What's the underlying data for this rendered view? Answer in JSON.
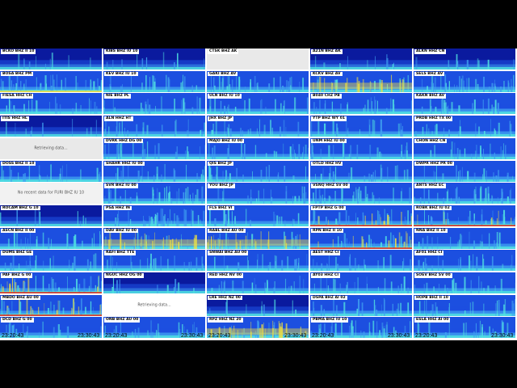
{
  "columns": [
    [
      {
        "label": "BCKO BHZ II 10",
        "state": "spec",
        "style": "dark"
      },
      {
        "label": "BOSA BHZ PM",
        "state": "spec",
        "style": "banded"
      },
      {
        "label": "FIESA HHZ CH",
        "state": "spec",
        "style": "medium"
      },
      {
        "label": "ITIS HHZ HL",
        "state": "spec",
        "style": "dark"
      },
      {
        "label": "",
        "state": "retrieving",
        "message": "Retrieving data..."
      },
      {
        "label": "DOSS BHZ II 10",
        "state": "spec",
        "style": "medium"
      },
      {
        "label": "",
        "state": "nodata",
        "message": "No recent data for FURI BHZ IU 10"
      },
      {
        "label": "ROCAM BHZ G 10",
        "state": "spec",
        "style": "dark"
      },
      {
        "label": "ASCN BHZ II 00",
        "state": "spec",
        "style": "medium"
      },
      {
        "label": "DUMS BHZ GE",
        "state": "spec",
        "style": "medium"
      },
      {
        "label": "PAF BHZ G 00",
        "state": "spec",
        "style": "noisy"
      },
      {
        "label": "MBDO BHZ AU 00",
        "state": "spec",
        "style": "noisy"
      },
      {
        "label": "DCD BHZ G 00",
        "state": "spec",
        "style": "medium"
      }
    ],
    [
      {
        "label": "KIBS BHZ IU 10",
        "state": "spec",
        "style": "dark"
      },
      {
        "label": "KEV BHZ IU 10",
        "state": "spec",
        "style": "medium"
      },
      {
        "label": "NIE BHZ PL",
        "state": "spec",
        "style": "medium"
      },
      {
        "label": "ALN HHZ HT",
        "state": "spec",
        "style": "medium"
      },
      {
        "label": "DVRK HHZ DG 00",
        "state": "spec",
        "style": "medium"
      },
      {
        "label": "SHAHR HHZ IU 00",
        "state": "spec",
        "style": "medium"
      },
      {
        "label": "SVR BHZ IU 00",
        "state": "spec",
        "style": "bright"
      },
      {
        "label": "PSA HHZ IN",
        "state": "spec",
        "style": "bright"
      },
      {
        "label": "DAV BHZ IU 00",
        "state": "spec",
        "style": "yellow"
      },
      {
        "label": "RAFI BHZ TTE",
        "state": "spec",
        "style": "medium"
      },
      {
        "label": "NGUC HHZ OG 00",
        "state": "spec",
        "style": "dark"
      },
      {
        "label": "",
        "state": "white",
        "message": "Retrieving data..."
      },
      {
        "label": "ONB BHZ AU 00",
        "state": "spec",
        "style": "medium"
      }
    ],
    [
      {
        "label": "CTSK BHZ AK",
        "state": "retrieving",
        "message": ""
      },
      {
        "label": "GAKI BHZ AV",
        "state": "spec",
        "style": "bright"
      },
      {
        "label": "ULN BHZ IU 10",
        "state": "spec",
        "style": "medium"
      },
      {
        "label": "JHX BHZ JP",
        "state": "spec",
        "style": "medium"
      },
      {
        "label": "MAJO BHZ IU 00",
        "state": "spec",
        "style": "medium"
      },
      {
        "label": "QIS BHZ JP",
        "state": "spec",
        "style": "medium"
      },
      {
        "label": "YOU BHZ JP",
        "state": "spec",
        "style": "medium"
      },
      {
        "label": "FLS BHZ VI",
        "state": "spec",
        "style": "medium"
      },
      {
        "label": "RABL BHZ AU 00",
        "state": "spec",
        "style": "yellow"
      },
      {
        "label": "SNWAI BHZ AU 00",
        "state": "spec",
        "style": "medium"
      },
      {
        "label": "RED HHZ NV 00",
        "state": "spec",
        "style": "medium"
      },
      {
        "label": "LRE HHZ NZ 00",
        "state": "spec",
        "style": "dark"
      },
      {
        "label": "RPZ HHZ NZ 20",
        "state": "spec",
        "style": "yellow"
      }
    ],
    [
      {
        "label": "A21N BHZ AK",
        "state": "spec",
        "style": "dark"
      },
      {
        "label": "KCKV BHZ AV",
        "state": "spec",
        "style": "yellow"
      },
      {
        "label": "B040 CHZ PB",
        "state": "spec",
        "style": "medium"
      },
      {
        "label": "YTP BHZ WY 01",
        "state": "spec",
        "style": "medium"
      },
      {
        "label": "UNM HHZ IU 00",
        "state": "spec",
        "style": "medium"
      },
      {
        "label": "OTLD HHZ HV",
        "state": "spec",
        "style": "medium"
      },
      {
        "label": "VSNQ HHZ SV 00",
        "state": "spec",
        "style": "bright"
      },
      {
        "label": "FPTP BHZ G 00",
        "state": "spec",
        "style": "noisy"
      },
      {
        "label": "RPN BHZ II 10",
        "state": "spec",
        "style": "noisy"
      },
      {
        "label": "AEST HHZ CI",
        "state": "spec",
        "style": "medium"
      },
      {
        "label": "AY03 HHZ CI",
        "state": "spec",
        "style": "medium"
      },
      {
        "label": "DSPA BHZ AI 02",
        "state": "spec",
        "style": "medium"
      },
      {
        "label": "PBMA BHZ IU 10",
        "state": "spec",
        "style": "bright"
      }
    ],
    [
      {
        "label": "ALKN HHZ CN",
        "state": "spec",
        "style": "dark"
      },
      {
        "label": "SELS BHZ AV",
        "state": "spec",
        "style": "bright"
      },
      {
        "label": "KAKN BHZ AV",
        "state": "spec",
        "style": "medium"
      },
      {
        "label": "PRDB HHZ TX 00",
        "state": "spec",
        "style": "medium"
      },
      {
        "label": "CHON HHZ CN",
        "state": "spec",
        "style": "medium"
      },
      {
        "label": "DWPR HHZ PR 00",
        "state": "spec",
        "style": "medium"
      },
      {
        "label": "ANTS HHZ EC",
        "state": "spec",
        "style": "bright"
      },
      {
        "label": "ROBK BHZ IU 02",
        "state": "spec",
        "style": "noisy"
      },
      {
        "label": "NNA BHZ II 10",
        "state": "spec",
        "style": "medium"
      },
      {
        "label": "AF01 HHZ CI",
        "state": "spec",
        "style": "medium"
      },
      {
        "label": "SOEV BHZ SV 00",
        "state": "spec",
        "style": "medium"
      },
      {
        "label": "HOPB BHZ II 10",
        "state": "spec",
        "style": "medium"
      },
      {
        "label": "ESLA HHZ AI 00",
        "state": "spec",
        "style": "medium"
      }
    ]
  ],
  "time_axis": {
    "start": "23:20:43",
    "end": "23:30:43"
  },
  "palette": {
    "deep": "#0a1a9e",
    "mid": "#1c4fe0",
    "light": "#3fa0f0",
    "cyan": "#50e0e0",
    "yellow": "#f0e040",
    "red": "#e03020"
  }
}
